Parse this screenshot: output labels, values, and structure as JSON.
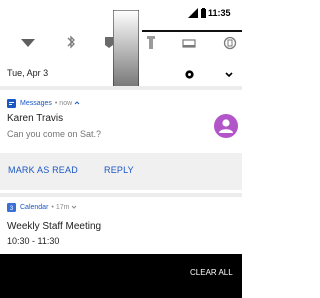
{
  "status_bar": {
    "time": "11:35",
    "icons": [
      "signal-icon",
      "battery-icon"
    ]
  },
  "quick_settings": {
    "tiles": [
      "wifi-icon",
      "bluetooth-icon",
      "dnd-icon",
      "flashlight-icon",
      "cast-icon",
      "auto-rotate-icon"
    ]
  },
  "header": {
    "date": "Tue, Apr 3",
    "icons": [
      "settings-icon",
      "expand-icon"
    ]
  },
  "messages_notification": {
    "app_name": "Messages",
    "meta": "• now",
    "sender": "Karen Travis",
    "preview": "Can you come on Sat.?",
    "actions": [
      "MARK AS READ",
      "REPLY"
    ],
    "avatar_color": "#b155c9",
    "accent_color": "#1a57c4"
  },
  "calendar_notification": {
    "app_name": "Calendar",
    "meta": "• 17m",
    "title": "Weekly Staff Meeting",
    "time": "10:30 - 11:30"
  },
  "footer": {
    "clear_all": "CLEAR ALL"
  }
}
